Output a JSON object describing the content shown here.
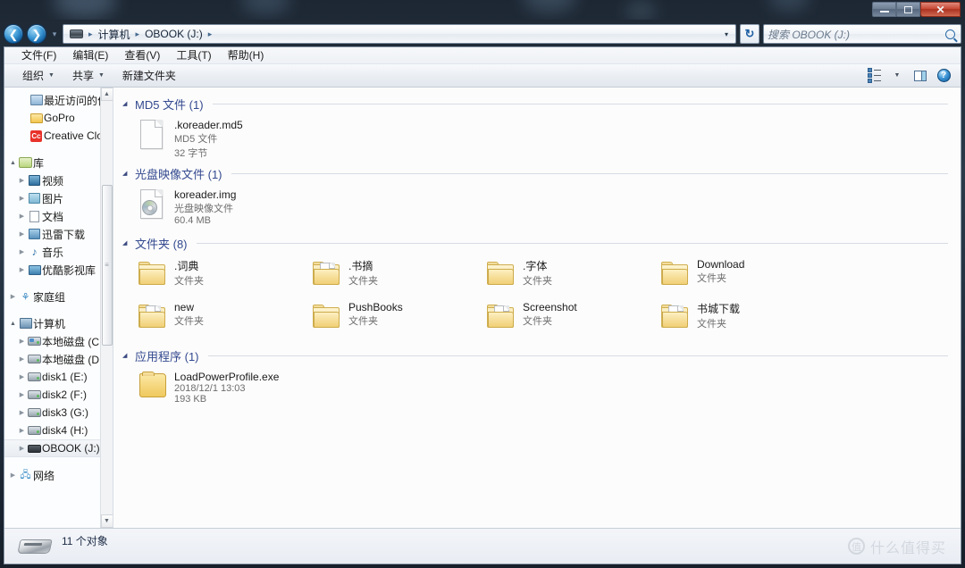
{
  "window": {
    "minimize_label": "",
    "maximize_label": "",
    "close_label": "✕"
  },
  "address": {
    "drive_icon": "drive-icon",
    "crumbs": [
      "计算机",
      "OBOOK (J:)"
    ],
    "separator": "▸",
    "dropdown_arrow": "▾",
    "refresh_label": "↻",
    "history_arrow": "▾"
  },
  "search": {
    "placeholder": "搜索 OBOOK (J:)",
    "icon": "search-icon"
  },
  "menubar": {
    "items": [
      {
        "label": "文件(F)"
      },
      {
        "label": "编辑(E)"
      },
      {
        "label": "查看(V)"
      },
      {
        "label": "工具(T)"
      },
      {
        "label": "帮助(H)"
      }
    ]
  },
  "toolbar": {
    "organize_label": "组织",
    "share_label": "共享",
    "newfolder_label": "新建文件夹",
    "caret": "▼",
    "view_icon": "view-options-icon",
    "preview_icon": "preview-pane-icon",
    "help_icon": "help-icon",
    "help_glyph": "?"
  },
  "navpane": {
    "favorites": [
      {
        "label": "最近访问的位",
        "icon": "recent-places-icon",
        "expander": "",
        "indent": 1
      },
      {
        "label": "GoPro",
        "icon": "folder-icon",
        "expander": "",
        "indent": 1
      },
      {
        "label": "Creative Clo",
        "icon": "creative-cloud-icon",
        "expander": "",
        "indent": 1
      }
    ],
    "libraries_root": {
      "label": "库",
      "icon": "library-icon",
      "expander": "▲"
    },
    "libraries": [
      {
        "label": "视频",
        "icon": "video-library-icon",
        "expander": "▶"
      },
      {
        "label": "图片",
        "icon": "pictures-library-icon",
        "expander": "▶"
      },
      {
        "label": "文档",
        "icon": "documents-library-icon",
        "expander": "▶"
      },
      {
        "label": "迅雷下载",
        "icon": "thunder-download-icon",
        "expander": "▶"
      },
      {
        "label": "音乐",
        "icon": "music-library-icon",
        "expander": "▶"
      },
      {
        "label": "优酷影视库",
        "icon": "youku-library-icon",
        "expander": "▶"
      }
    ],
    "homegroup": {
      "label": "家庭组",
      "icon": "homegroup-icon",
      "expander": "▶"
    },
    "computer_root": {
      "label": "计算机",
      "icon": "computer-icon",
      "expander": "▲"
    },
    "drives": [
      {
        "label": "本地磁盘 (C:",
        "icon": "system-drive-icon",
        "expander": "▶",
        "selected": false
      },
      {
        "label": "本地磁盘 (D:",
        "icon": "drive-icon",
        "expander": "▶",
        "selected": false
      },
      {
        "label": "disk1 (E:)",
        "icon": "drive-icon",
        "expander": "▶",
        "selected": false
      },
      {
        "label": "disk2 (F:)",
        "icon": "drive-icon",
        "expander": "▶",
        "selected": false
      },
      {
        "label": "disk3 (G:)",
        "icon": "drive-icon",
        "expander": "▶",
        "selected": false
      },
      {
        "label": "disk4 (H:)",
        "icon": "drive-icon",
        "expander": "▶",
        "selected": false
      },
      {
        "label": "OBOOK (J:)",
        "icon": "usb-drive-icon",
        "expander": "▶",
        "selected": true
      }
    ],
    "network": {
      "label": "网络",
      "icon": "network-icon",
      "expander": "▶"
    },
    "scroll_up": "▲",
    "scroll_down": "▼",
    "grip": "≡"
  },
  "content": {
    "groups": [
      {
        "header": "MD5 文件 (1)",
        "collapse": "◢",
        "icon_kind": "document",
        "items": [
          {
            "name": ".koreader.md5",
            "line2": "MD5 文件",
            "line3": "32 字节",
            "icon": "md5-file-icon"
          }
        ]
      },
      {
        "header": "光盘映像文件 (1)",
        "collapse": "◢",
        "icon_kind": "disc",
        "items": [
          {
            "name": "koreader.img",
            "line2": "光盘映像文件",
            "line3": "60.4 MB",
            "icon": "disc-image-icon"
          }
        ]
      },
      {
        "header": "文件夹 (8)",
        "collapse": "◢",
        "icon_kind": "folder",
        "items": [
          {
            "name": ".词典",
            "line2": "文件夹",
            "line3": "",
            "icon": "folder-icon",
            "hasdoc": false
          },
          {
            "name": ".书摘",
            "line2": "文件夹",
            "line3": "",
            "icon": "folder-with-files-icon",
            "hasdoc": true
          },
          {
            "name": ".字体",
            "line2": "文件夹",
            "line3": "",
            "icon": "folder-icon",
            "hasdoc": false
          },
          {
            "name": "Download",
            "line2": "文件夹",
            "line3": "",
            "icon": "folder-icon",
            "hasdoc": false
          },
          {
            "name": "new",
            "line2": "文件夹",
            "line3": "",
            "icon": "folder-with-files-icon",
            "hasdoc": true
          },
          {
            "name": "PushBooks",
            "line2": "文件夹",
            "line3": "",
            "icon": "folder-icon",
            "hasdoc": false
          },
          {
            "name": "Screenshot",
            "line2": "文件夹",
            "line3": "",
            "icon": "folder-with-files-icon",
            "hasdoc": true
          },
          {
            "name": "书城下载",
            "line2": "文件夹",
            "line3": "",
            "icon": "folder-with-files-icon",
            "hasdoc": true
          }
        ]
      },
      {
        "header": "应用程序 (1)",
        "collapse": "◢",
        "icon_kind": "exe",
        "items": [
          {
            "name": "LoadPowerProfile.exe",
            "line2": "2018/12/1 13:03",
            "line3": "193 KB",
            "icon": "application-icon"
          }
        ]
      }
    ]
  },
  "statusbar": {
    "count_label": "11 个对象",
    "drive_icon": "usb-drive-icon"
  },
  "watermark": {
    "mark": "值",
    "text": "什么值得买"
  },
  "colors": {
    "group_header": "#33498f",
    "accent_blue": "#1c5ea3",
    "close_red": "#c74a35"
  }
}
